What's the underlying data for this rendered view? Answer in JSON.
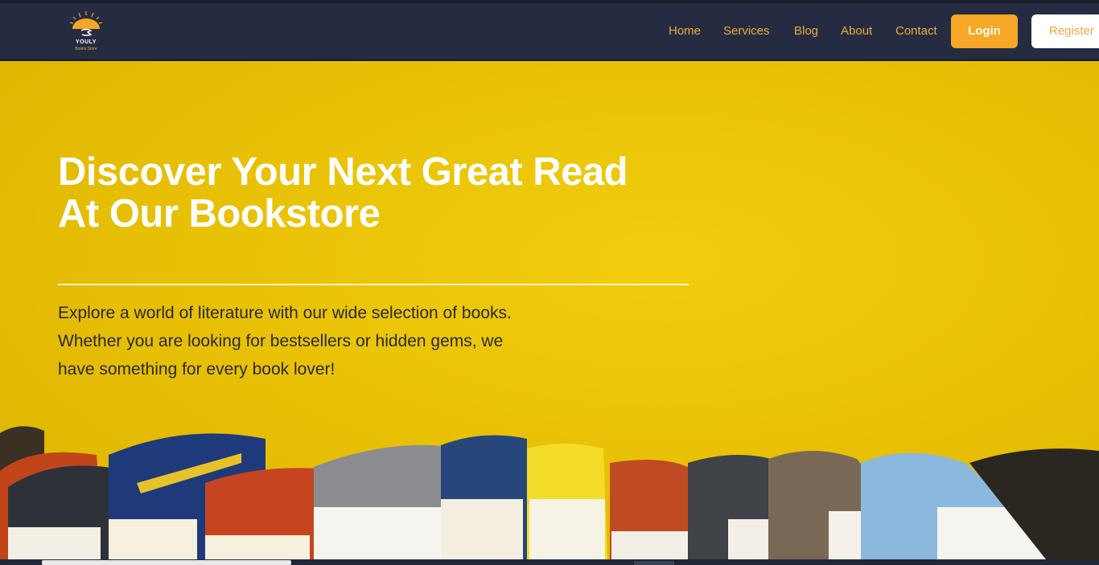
{
  "brand": {
    "name": "YOULY",
    "tagline": "Books Store"
  },
  "nav": {
    "links": [
      "Home",
      "Services",
      "Blog",
      "About",
      "Contact"
    ],
    "login_label": "Login",
    "register_label": "Register"
  },
  "hero": {
    "title_line1": "Discover Your Next Great Read",
    "title_line2": "At Our Bookstore",
    "description": "Explore a world of literature with our wide selection of books. Whether you are looking for bestsellers or hidden gems, we have something for every book lover!"
  },
  "colors": {
    "navbar": "#252c41",
    "accent": "#f6a725",
    "hero_background": "#e9c207",
    "nav_link": "#f0a93b"
  }
}
